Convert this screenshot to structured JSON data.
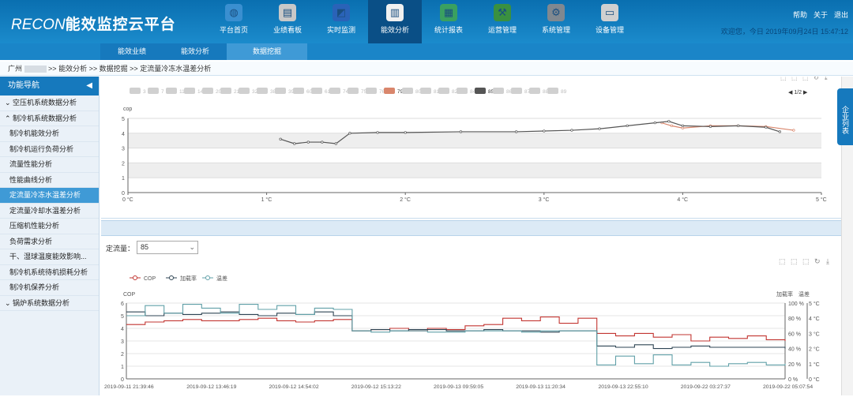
{
  "app": {
    "brand": "RECON",
    "title": "能效监控云平台"
  },
  "nav": [
    {
      "label": "平台首页",
      "icon": "globe-icon",
      "color": "#3a8fd0"
    },
    {
      "label": "业绩看板",
      "icon": "chart-board-icon",
      "color": "#c8c8c8"
    },
    {
      "label": "实时监测",
      "icon": "monitor-icon",
      "color": "#2a63b8"
    },
    {
      "label": "能效分析",
      "icon": "bar-chart-icon",
      "color": "#f0f0f0"
    },
    {
      "label": "统计报表",
      "icon": "report-icon",
      "color": "#3aa060"
    },
    {
      "label": "运营管理",
      "icon": "worker-icon",
      "color": "#3a9040"
    },
    {
      "label": "系统管理",
      "icon": "gear-icon",
      "color": "#808890"
    },
    {
      "label": "设备管理",
      "icon": "device-icon",
      "color": "#d0d0d0"
    }
  ],
  "toplinks": [
    "帮助",
    "关于",
    "退出"
  ],
  "topinfo": "欢迎您，今日 2019年09月24日 15:47:12",
  "subnav": [
    "能效业绩",
    "能效分析",
    "数据挖掘"
  ],
  "breadcrumb": {
    "parts": [
      "广州",
      ">>",
      "能效分析",
      ">>",
      "数据挖掘",
      ">>",
      "定流量冷冻水温差分析"
    ]
  },
  "sidebar": {
    "title": "功能导航",
    "items": [
      {
        "label": "⌄ 空压机系统数据分析",
        "type": "group"
      },
      {
        "label": "⌃ 制冷机系统数据分析",
        "type": "group"
      },
      {
        "label": "制冷机能效分析",
        "type": "item"
      },
      {
        "label": "制冷机运行负荷分析",
        "type": "item"
      },
      {
        "label": "流量性能分析",
        "type": "item"
      },
      {
        "label": "性能曲线分析",
        "type": "item"
      },
      {
        "label": "定流量冷冻水温差分析",
        "type": "active"
      },
      {
        "label": "定流量冷却水温差分析",
        "type": "item"
      },
      {
        "label": "压缩机性能分析",
        "type": "item"
      },
      {
        "label": "负荷需求分析",
        "type": "item"
      },
      {
        "label": "干、湿球温度能效影响...",
        "type": "item"
      },
      {
        "label": "制冷机系统待机损耗分析",
        "type": "item"
      },
      {
        "label": "制冷机保养分析",
        "type": "item"
      },
      {
        "label": "⌄ 锅炉系统数据分析",
        "type": "group"
      }
    ]
  },
  "enterprise_list": "企业列表",
  "selector": {
    "label": "定流量：",
    "value": "85"
  },
  "chart_data": [
    {
      "type": "line",
      "legend_items": [
        "3",
        "7",
        "11",
        "14",
        "20",
        "21",
        "32",
        "38",
        "39",
        "60",
        "61",
        "74",
        "75",
        "76",
        "79",
        "80",
        "81",
        "82",
        "84",
        "85",
        "86",
        "87",
        "88",
        "89"
      ],
      "legend_active": {
        "79": "#d9866c",
        "85": "#555555"
      },
      "legend_page": "1/2",
      "ylabel": "cop",
      "ylim": [
        0,
        5
      ],
      "yticks": [
        "0",
        "1",
        "2",
        "3",
        "4",
        "5"
      ],
      "xlim": [
        0,
        5
      ],
      "xticks": [
        "0 °C",
        "1 °C",
        "2 °C",
        "3 °C",
        "4 °C",
        "5 °C"
      ],
      "series": [
        {
          "name": "79",
          "color": "#d9866c",
          "x": [
            3.85,
            3.92,
            4.0,
            4.2,
            4.4,
            4.6,
            4.8
          ],
          "y": [
            4.7,
            4.5,
            4.35,
            4.5,
            4.5,
            4.45,
            4.2
          ]
        },
        {
          "name": "85",
          "color": "#555555",
          "x": [
            1.1,
            1.2,
            1.3,
            1.4,
            1.5,
            1.6,
            1.8,
            2.0,
            2.4,
            2.8,
            3.0,
            3.2,
            3.4,
            3.6,
            3.8,
            3.9,
            4.0,
            4.2,
            4.4,
            4.6,
            4.7
          ],
          "y": [
            3.6,
            3.3,
            3.4,
            3.4,
            3.3,
            4.0,
            4.05,
            4.05,
            4.1,
            4.1,
            4.15,
            4.2,
            4.3,
            4.5,
            4.7,
            4.8,
            4.5,
            4.45,
            4.5,
            4.4,
            4.1
          ]
        }
      ]
    },
    {
      "type": "line",
      "legend": [
        "COP",
        "加载率",
        "温差"
      ],
      "colors": [
        "#c23531",
        "#2f4554",
        "#61a0a8"
      ],
      "ylabel_left": "COP",
      "ylabel_right": [
        "加载率",
        "温差"
      ],
      "yticks_left": [
        "0",
        "1",
        "2",
        "3",
        "4",
        "5",
        "6"
      ],
      "yticks_right1": [
        "0 %",
        "20 %",
        "40 %",
        "60 %",
        "80 %",
        "100 %"
      ],
      "yticks_right2": [
        "0 °C",
        "1 °C",
        "2 °C",
        "3 °C",
        "4 °C",
        "5 °C"
      ],
      "xticks": [
        "2019-09-11 21:39:46",
        "2019-09-12 13:46:19",
        "2019-09-12 14:54:02",
        "2019-09-12 15:13:22",
        "2019-09-13 09:59:05",
        "2019-09-13 11:20:34",
        "2019-09-13 22:55:10",
        "2019-09-22 03:27:37",
        "2019-09-22 05:07:54"
      ],
      "series": [
        {
          "name": "COP",
          "values": [
            4.3,
            4.5,
            4.6,
            4.7,
            4.6,
            4.6,
            4.7,
            4.8,
            4.6,
            4.5,
            4.6,
            4.7,
            3.8,
            3.9,
            4.0,
            3.8,
            4.0,
            3.9,
            4.2,
            4.3,
            4.8,
            4.6,
            4.9,
            4.4,
            4.8,
            3.6,
            3.4,
            3.6,
            3.3,
            3.5,
            3.0,
            3.3,
            3.2,
            3.4,
            3.1,
            3.0
          ]
        },
        {
          "name": "加载率",
          "values": [
            5.3,
            5.0,
            5.2,
            5.1,
            5.2,
            5.3,
            5.1,
            5.0,
            5.2,
            5.1,
            5.3,
            5.0,
            3.8,
            3.9,
            3.8,
            3.9,
            3.9,
            3.8,
            3.8,
            3.9,
            3.8,
            3.8,
            3.7,
            3.8,
            3.8,
            2.6,
            2.5,
            2.7,
            2.4,
            2.5,
            2.6,
            2.5,
            2.5,
            2.5,
            2.5,
            2.4
          ]
        },
        {
          "name": "温差",
          "values": [
            5.0,
            5.8,
            5.2,
            5.9,
            5.6,
            5.2,
            5.9,
            5.5,
            5.8,
            5.1,
            5.6,
            5.5,
            3.8,
            3.7,
            3.8,
            3.8,
            3.7,
            3.7,
            3.8,
            3.8,
            3.8,
            3.7,
            3.8,
            3.8,
            3.8,
            1.1,
            1.8,
            1.2,
            1.9,
            1.1,
            1.3,
            1.0,
            1.2,
            1.3,
            1.1,
            1.2
          ]
        }
      ]
    }
  ]
}
